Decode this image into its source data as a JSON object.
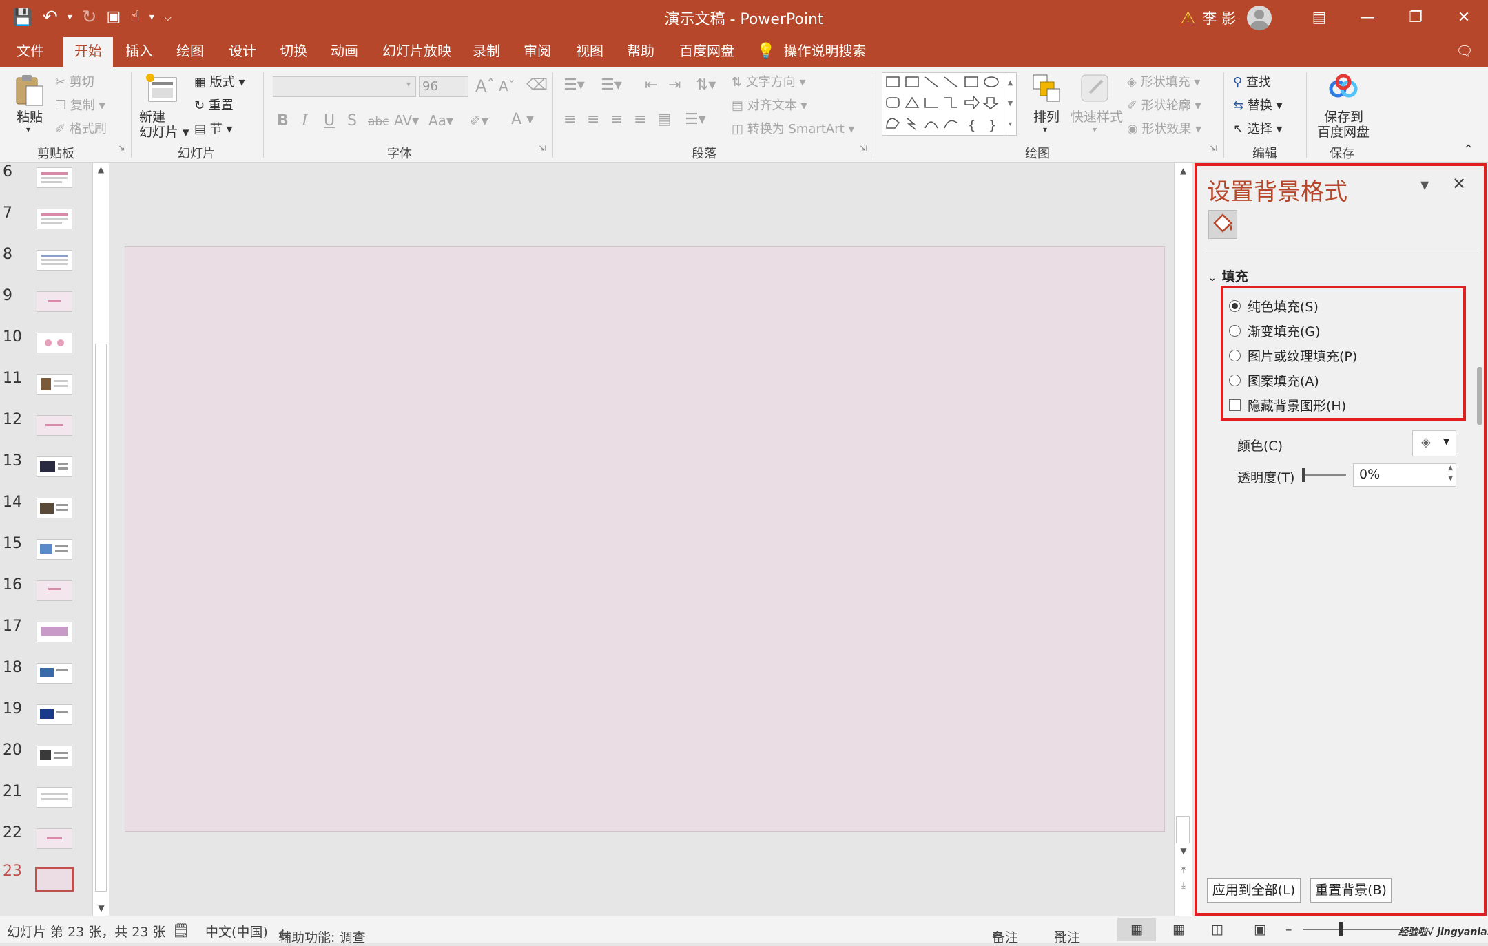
{
  "window": {
    "title": "演示文稿 - PowerPoint",
    "user_name": "李 影",
    "accent_color": "#b7472a",
    "highlight_color": "#e02020"
  },
  "quick_access": {
    "icons": [
      "save-icon",
      "undo-icon",
      "redo-icon",
      "present-icon",
      "touch-mode-icon",
      "customize-icon"
    ]
  },
  "tabs": [
    {
      "label": "文件"
    },
    {
      "label": "开始"
    },
    {
      "label": "插入"
    },
    {
      "label": "绘图"
    },
    {
      "label": "设计"
    },
    {
      "label": "切换"
    },
    {
      "label": "动画"
    },
    {
      "label": "幻灯片放映"
    },
    {
      "label": "录制"
    },
    {
      "label": "审阅"
    },
    {
      "label": "视图"
    },
    {
      "label": "帮助"
    },
    {
      "label": "百度网盘"
    }
  ],
  "tell_me": "操作说明搜索",
  "ribbon": {
    "clipboard": {
      "paste": "粘贴",
      "cut": "剪切",
      "copy": "复制",
      "format_painter": "格式刷",
      "label": "剪贴板"
    },
    "slides": {
      "new_slide": "新建",
      "new_slide2": "幻灯片",
      "layout": "版式",
      "reset": "重置",
      "section": "节",
      "label": "幻灯片"
    },
    "font": {
      "font_name": "",
      "font_size": "96",
      "label": "字体"
    },
    "paragraph": {
      "text_direction": "文字方向",
      "align_text": "对齐文本",
      "smartart": "转换为 SmartArt",
      "label": "段落"
    },
    "drawing": {
      "arrange": "排列",
      "quick_styles": "快速样式",
      "shape_fill": "形状填充",
      "shape_outline": "形状轮廓",
      "shape_effects": "形状效果",
      "label": "绘图"
    },
    "editing": {
      "find": "查找",
      "replace": "替换",
      "select": "选择",
      "label": "编辑"
    },
    "save": {
      "line1": "保存到",
      "line2": "百度网盘",
      "label": "保存"
    }
  },
  "thumbnails": [
    {
      "num": "6"
    },
    {
      "num": "7"
    },
    {
      "num": "8"
    },
    {
      "num": "9"
    },
    {
      "num": "10"
    },
    {
      "num": "11"
    },
    {
      "num": "12"
    },
    {
      "num": "13"
    },
    {
      "num": "14"
    },
    {
      "num": "15"
    },
    {
      "num": "16"
    },
    {
      "num": "17"
    },
    {
      "num": "18"
    },
    {
      "num": "19"
    },
    {
      "num": "20"
    },
    {
      "num": "21"
    },
    {
      "num": "22"
    },
    {
      "num": "23"
    }
  ],
  "format_pane": {
    "title": "设置背景格式",
    "section": "填充",
    "options": [
      {
        "label": "纯色填充(S)",
        "checked": true
      },
      {
        "label": "渐变填充(G)",
        "checked": false
      },
      {
        "label": "图片或纹理填充(P)",
        "checked": false
      },
      {
        "label": "图案填充(A)",
        "checked": false
      }
    ],
    "hide_bg_graphics": "隐藏背景图形(H)",
    "color_label": "颜色(C)",
    "transparency_label": "透明度(T)",
    "transparency_value": "0%",
    "apply_all": "应用到全部(L)",
    "reset_bg": "重置背景(B)"
  },
  "status": {
    "slide_info": "幻灯片 第 23 张，共 23 张",
    "language": "中文(中国)",
    "accessibility": "辅助功能: 调查",
    "notes": "备注",
    "comments": "批注"
  },
  "watermark": "经验啦√ jingyanla.com"
}
